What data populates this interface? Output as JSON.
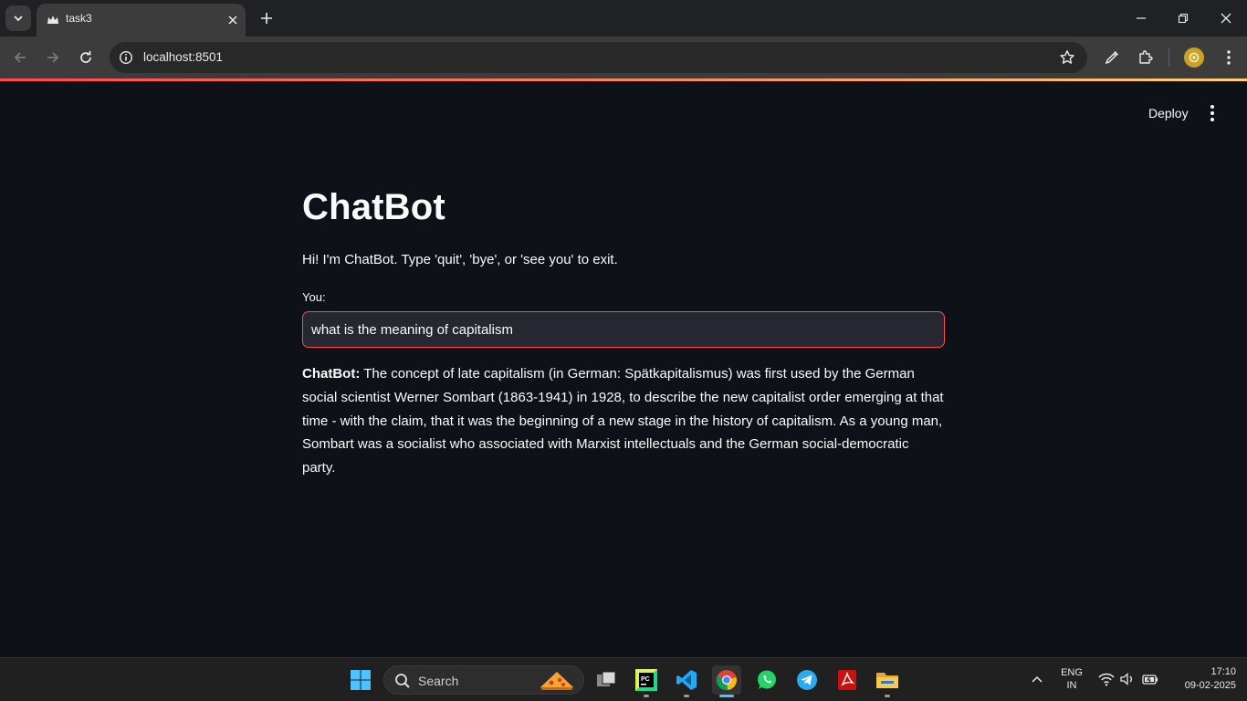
{
  "browser": {
    "tab": {
      "title": "task3"
    },
    "address": {
      "url": "localhost:8501"
    }
  },
  "app": {
    "header": {
      "deploy_label": "Deploy"
    },
    "title": "ChatBot",
    "intro": "Hi! I'm ChatBot. Type 'quit', 'bye', or 'see you' to exit.",
    "input": {
      "label": "You:",
      "value": "what is the meaning of capitalism"
    },
    "response": {
      "speaker": "ChatBot:",
      "text": "The concept of late capitalism (in German: Spätkapitalismus) was first used by the German social scientist Werner Sombart (1863-1941) in 1928, to describe the new capitalist order emerging at that time - with the claim, that it was the beginning of a new stage in the history of capitalism. As a young man, Sombart was a socialist who associated with Marxist intellectuals and the German social-democratic party."
    }
  },
  "taskbar": {
    "search_label": "Search",
    "apps": [
      "task-view",
      "pycharm",
      "vscode",
      "chrome",
      "whatsapp",
      "telegram",
      "acrobat",
      "file-explorer"
    ],
    "language": {
      "line1": "ENG",
      "line2": "IN"
    },
    "clock": {
      "time": "17:10",
      "date": "09-02-2025"
    }
  },
  "colors": {
    "page_bg": "#0e1117",
    "accent": "#ff4b4b",
    "text": "#fafafa",
    "input_bg": "#262730"
  }
}
